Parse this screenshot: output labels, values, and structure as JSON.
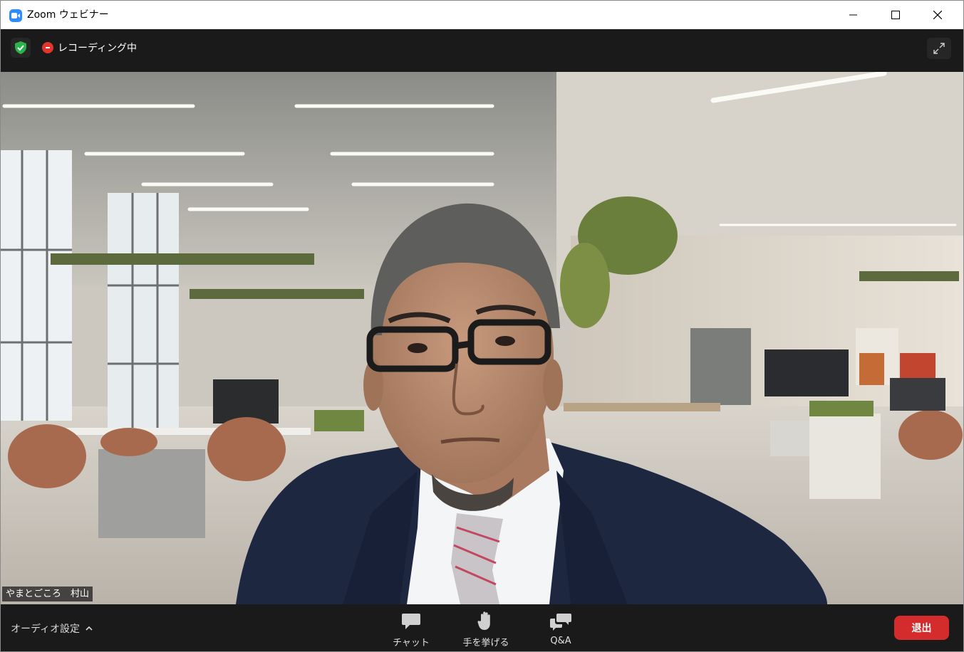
{
  "window": {
    "title": "Zoom ウェビナー"
  },
  "topbar": {
    "recording_label": "レコーディング中"
  },
  "video": {
    "participant_name": "やまとごころ　村山"
  },
  "bottombar": {
    "audio_settings_label": "オーディオ設定",
    "chat_label": "チャット",
    "raise_hand_label": "手を挙げる",
    "qa_label": "Q&A",
    "leave_label": "退出"
  },
  "colors": {
    "accent": "#2d8cff",
    "recording": "#e0352b",
    "leave": "#d42c2c",
    "secure": "#2bb24c"
  },
  "icons": [
    "zoom-app-icon",
    "minimize-icon",
    "maximize-icon",
    "close-icon",
    "security-shield-icon",
    "recording-icon",
    "fullscreen-icon",
    "chevron-up-icon",
    "chat-icon",
    "raise-hand-icon",
    "qa-icon"
  ]
}
